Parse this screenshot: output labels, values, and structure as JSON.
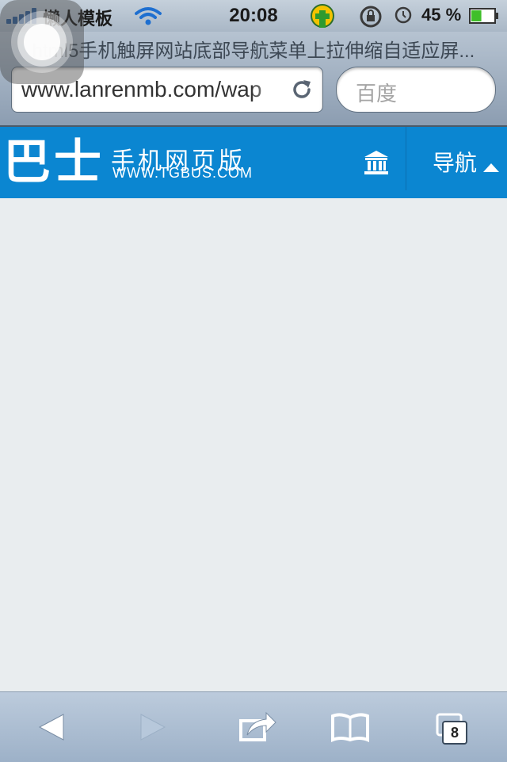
{
  "status_bar": {
    "carrier": "懒人模板",
    "time": "20:08",
    "battery_percent": "45 %",
    "battery_level": 0.45,
    "icons": [
      "signal-icon",
      "wifi-icon",
      "app-icon",
      "rotation-lock-icon",
      "alarm-icon",
      "battery-icon"
    ]
  },
  "browser": {
    "page_title": "html5手机触屏网站底部导航菜单上拉伸缩自适应屏...",
    "url": "www.lanrenmb.com/wap",
    "search_placeholder": "百度"
  },
  "site_header": {
    "logo_main": "巴士",
    "logo_subtitle": "手机网页版",
    "logo_url": "WWW.TGBUS.COM",
    "nav_label": "导航",
    "accent_color": "#0b86d1"
  },
  "toolbar": {
    "tabs_count": "8",
    "icons": [
      "back-icon",
      "forward-icon",
      "share-icon",
      "bookmarks-icon",
      "tabs-icon"
    ]
  }
}
